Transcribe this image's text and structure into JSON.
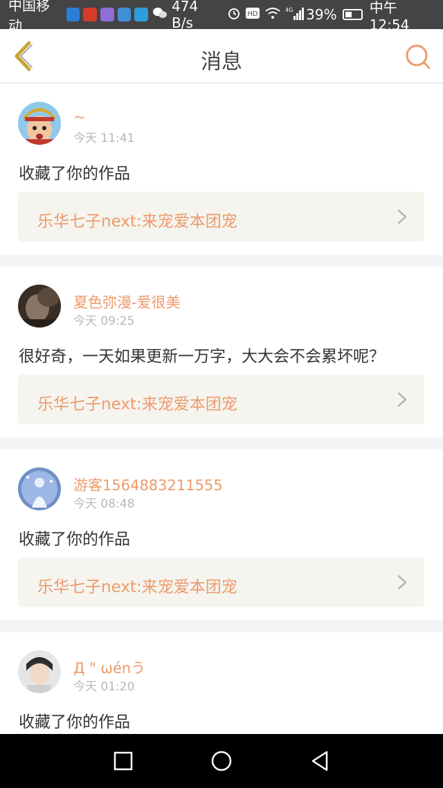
{
  "status_bar": {
    "carrier": "中国移动",
    "net_speed": "474 B/s",
    "network_type": "4G",
    "battery_level": "39%",
    "battery_fraction": 0.39,
    "time": "中午12:54",
    "icons": [
      "shield-app-icon",
      "news-app-icon",
      "mail-app-icon",
      "chat-app-icon",
      "browser-app-icon",
      "wechat-icon",
      "alarm-icon",
      "hd-icon",
      "wifi-icon",
      "signal-icon",
      "battery-icon"
    ]
  },
  "header": {
    "title": "消息",
    "back_icon": "chevron-left-icon",
    "search_icon": "search-icon"
  },
  "colors": {
    "accent": "#ee9a6c",
    "back_icon": "#c9a436",
    "status_bar_bg": "#444444",
    "card_link_bg": "#f5f4ee"
  },
  "messages": [
    {
      "user": "~",
      "time": "今天 11:41",
      "text": "收藏了你的作品",
      "work_title": "乐华七子next:来宠爱本团宠"
    },
    {
      "user": "夏色弥漫-爱很美",
      "time": "今天 09:25",
      "text": "很好奇，一天如果更新一万字，大大会不会累坏呢？",
      "work_title": "乐华七子next:来宠爱本团宠"
    },
    {
      "user": "游客1564883211555",
      "time": "今天 08:48",
      "text": "收藏了你的作品",
      "work_title": "乐华七子next:来宠爱本团宠"
    },
    {
      "user": "Д \" ωénう",
      "time": "今天 01:20",
      "text": "收藏了你的作品"
    }
  ],
  "nav": {
    "icons": [
      "recents-square-icon",
      "home-circle-icon",
      "back-triangle-icon"
    ]
  }
}
